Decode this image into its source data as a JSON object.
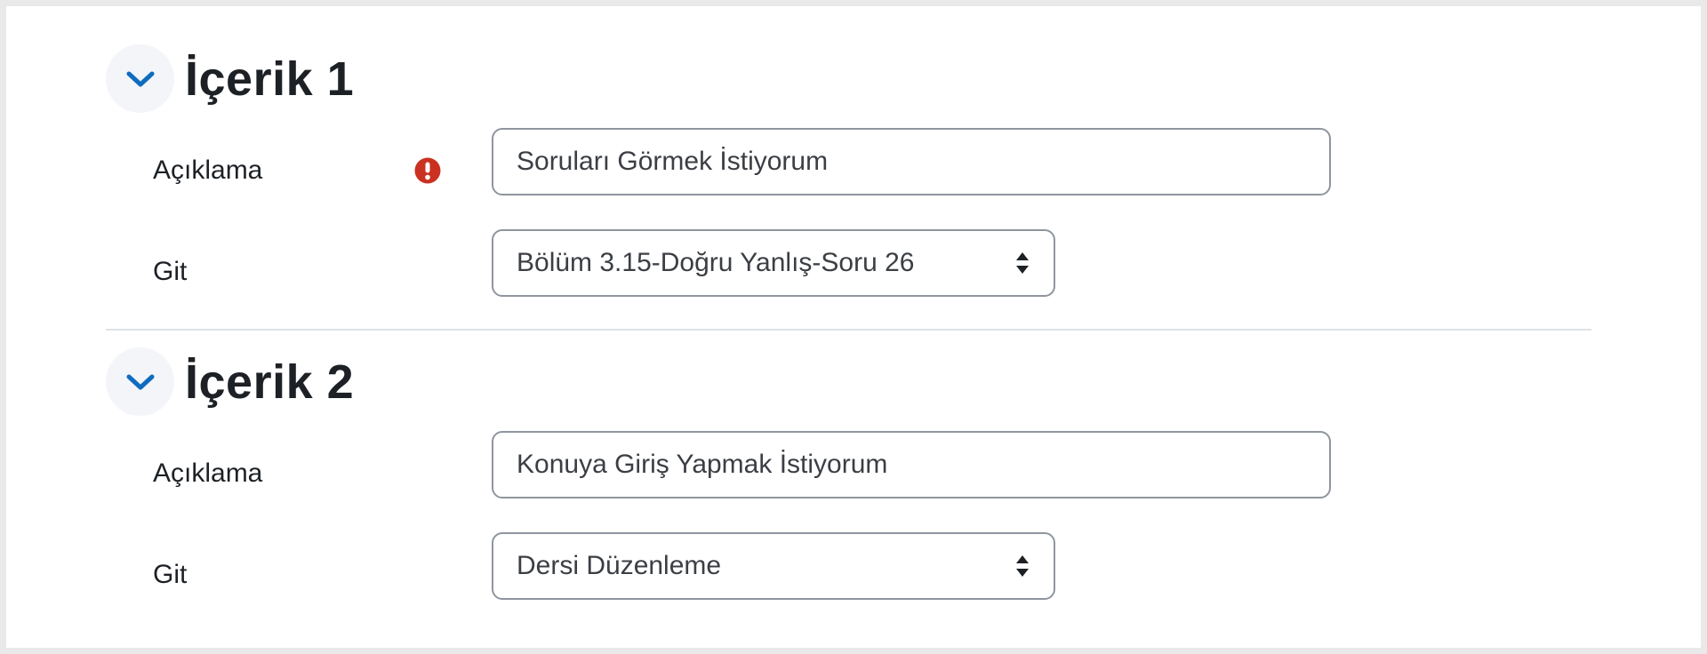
{
  "sections": [
    {
      "title": "İçerik 1",
      "description_label": "Açıklama",
      "description_value": "Soruları Görmek İstiyorum",
      "description_required": true,
      "goto_label": "Git",
      "goto_value": "Bölüm 3.15-Doğru Yanlış-Soru 26"
    },
    {
      "title": "İçerik 2",
      "description_label": "Açıklama",
      "description_value": "Konuya Giriş Yapmak İstiyorum",
      "description_required": false,
      "goto_label": "Git",
      "goto_value": "Dersi Düzenleme"
    }
  ],
  "icons": {
    "toggle": "chevron-down-icon",
    "required": "exclamation-circle-icon",
    "select": "sort-arrows-icon"
  },
  "colors": {
    "accent": "#0f6cbf",
    "required": "#ca3120",
    "text": "#1d2125",
    "input_border": "#8f959e",
    "divider": "#dee2e6",
    "toggle_bg": "#f3f5f9"
  }
}
